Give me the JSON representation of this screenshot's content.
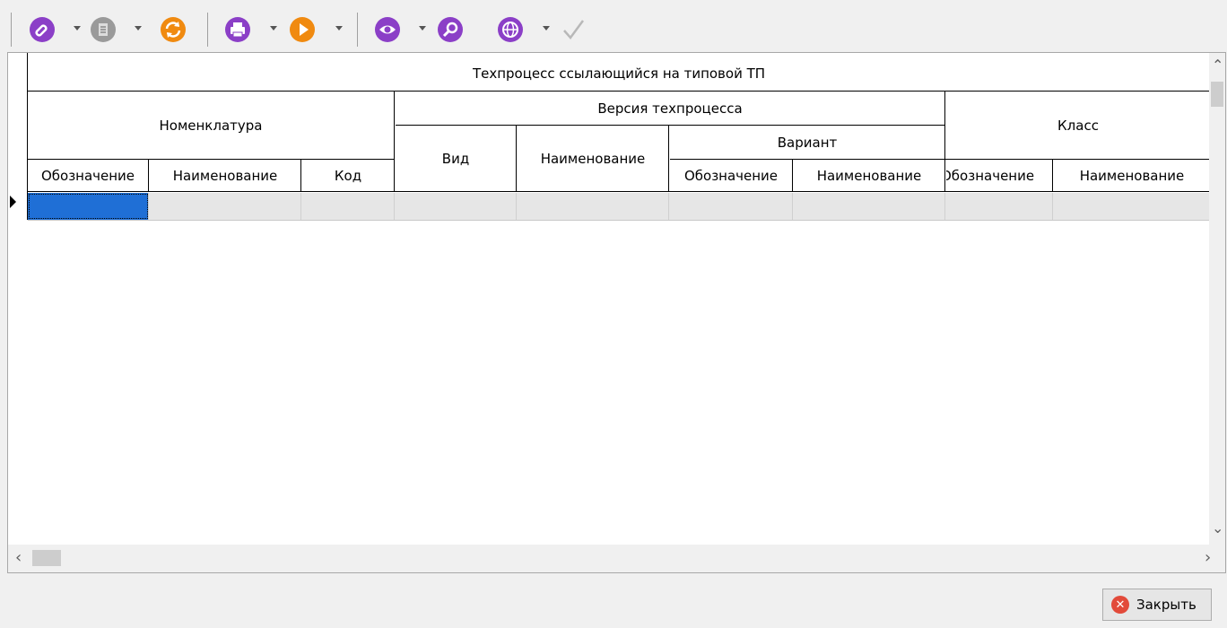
{
  "toolbar": {
    "buttons": [
      {
        "icon": "link-icon",
        "color": "#8b3fc7"
      },
      {
        "icon": "document-icon",
        "color": "#9a9a9a"
      },
      {
        "icon": "refresh-icon",
        "color": "#f08a10"
      },
      {
        "icon": "print-icon",
        "color": "#8b3fc7"
      },
      {
        "icon": "play-icon",
        "color": "#f08a10"
      },
      {
        "icon": "eye-icon",
        "color": "#8b3fc7"
      },
      {
        "icon": "search-icon",
        "color": "#8b3fc7"
      },
      {
        "icon": "globe-icon",
        "color": "#8b3fc7"
      },
      {
        "icon": "check-icon",
        "color": "#b8b8b8"
      }
    ]
  },
  "grid": {
    "top_header": "Техпроцесс ссылающийся на типовой ТП",
    "groups": {
      "nomenclature": "Номенклатура",
      "version": "Версия техпроцесса",
      "variant": "Вариант",
      "klass": "Класс"
    },
    "columns": {
      "nom_designation": "Обозначение",
      "nom_name": "Наименование",
      "nom_code": "Код",
      "ver_kind": "Вид",
      "ver_name": "Наименование",
      "var_designation": "Обозначение",
      "var_name": "Наименование",
      "cls_designation": "Обозначение",
      "cls_name": "Наименование"
    }
  },
  "buttons": {
    "close_label": "Закрыть"
  },
  "colors": {
    "selection": "#1f6fd6",
    "accent_purple": "#8b3fc7",
    "accent_orange": "#f08a10"
  }
}
